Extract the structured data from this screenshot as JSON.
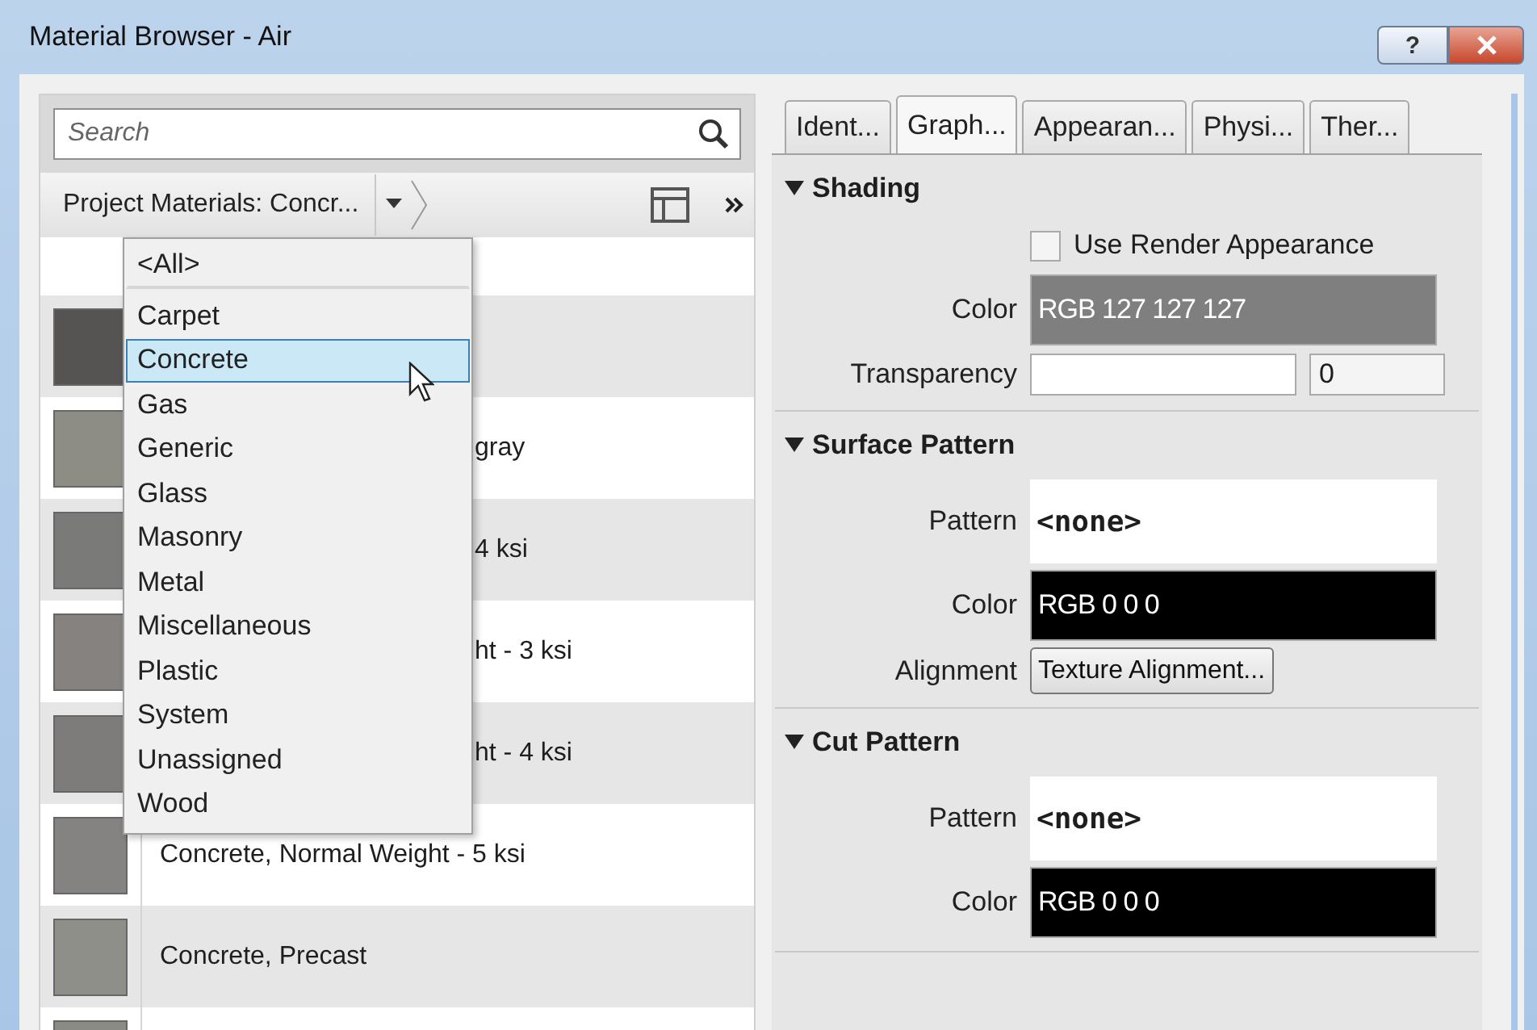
{
  "window": {
    "title": "Material Browser - Air",
    "buttons": [
      {
        "kind": "help",
        "label": "?"
      },
      {
        "kind": "close"
      }
    ]
  },
  "search": {
    "placeholder": "Search"
  },
  "filter": {
    "label": "Project Materials: Concr..."
  },
  "dropdown": {
    "items": [
      {
        "label": "<All>",
        "selected": false,
        "kind": "all"
      },
      {
        "label": "Carpet",
        "selected": false,
        "kind": "category"
      },
      {
        "label": "Concrete",
        "selected": true,
        "kind": "category"
      },
      {
        "label": "Gas",
        "selected": false,
        "kind": "category"
      },
      {
        "label": "Generic",
        "selected": false,
        "kind": "category"
      },
      {
        "label": "Glass",
        "selected": false,
        "kind": "category"
      },
      {
        "label": "Masonry",
        "selected": false,
        "kind": "category"
      },
      {
        "label": "Metal",
        "selected": false,
        "kind": "category"
      },
      {
        "label": "Miscellaneous",
        "selected": false,
        "kind": "category"
      },
      {
        "label": "Plastic",
        "selected": false,
        "kind": "category"
      },
      {
        "label": "System",
        "selected": false,
        "kind": "category"
      },
      {
        "label": "Unassigned",
        "selected": false,
        "kind": "category"
      },
      {
        "label": "Wood",
        "selected": false,
        "kind": "category"
      }
    ]
  },
  "materials": [
    {
      "color": "#555453"
    },
    {
      "name": "gray",
      "kind": "covered",
      "color": "#8d8d86"
    },
    {
      "name": "4 ksi",
      "kind": "covered",
      "color": "#7a7a78"
    },
    {
      "name": "ht - 3 ksi",
      "kind": "covered",
      "color": "#868280"
    },
    {
      "name": "ht - 4 ksi",
      "kind": "covered",
      "color": "#7e7c7a"
    },
    {
      "name": "Concrete, Normal Weight - 5 ksi",
      "kind": "full",
      "color": "#858382"
    },
    {
      "name": "Concrete, Precast",
      "kind": "full",
      "color": "#8e8f88"
    },
    {
      "color": "#8a8b85"
    }
  ],
  "tabs": [
    {
      "label": "Ident...",
      "selected": false
    },
    {
      "label": "Graph...",
      "selected": true
    },
    {
      "label": "Appearan...",
      "selected": false
    },
    {
      "label": "Physi...",
      "selected": false
    },
    {
      "label": "Ther...",
      "selected": false
    }
  ],
  "sections": [
    {
      "title": "Shading",
      "expanded": true,
      "rows": [
        {
          "kind": "checkbox",
          "label": "Use Render Appearance",
          "checked": false
        },
        {
          "kind": "color",
          "label": "Color",
          "value": "RGB 127 127 127",
          "color": "#7f7f7f"
        },
        {
          "kind": "slider",
          "label": "Transparency",
          "value": "0"
        }
      ]
    },
    {
      "title": "Surface Pattern",
      "expanded": true,
      "rows": [
        {
          "kind": "pattern",
          "label": "Pattern",
          "value": "<none>"
        },
        {
          "kind": "color",
          "label": "Color",
          "value": "RGB 0 0 0",
          "color": "#000000"
        },
        {
          "kind": "button",
          "label": "Alignment",
          "value": "Texture Alignment..."
        }
      ]
    },
    {
      "title": "Cut Pattern",
      "expanded": true,
      "rows": [
        {
          "kind": "pattern",
          "label": "Pattern",
          "value": "<none>"
        },
        {
          "kind": "color",
          "label": "Color",
          "value": "RGB 0 0 0",
          "color": "#000000"
        }
      ]
    }
  ]
}
